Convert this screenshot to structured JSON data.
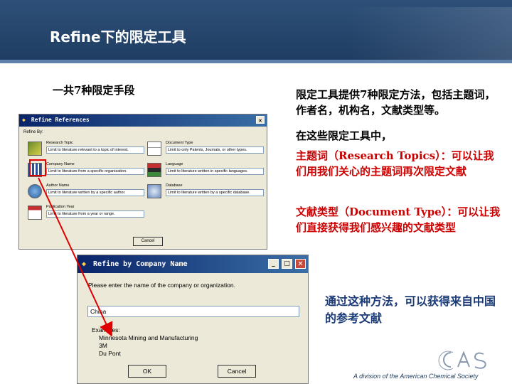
{
  "slide": {
    "title": "Refine下的限定工具",
    "subtitle": "一共7种限定手段",
    "paragraphs": [
      "限定工具提供7种限定方法，包括主题词，作者名，机构名，文献类型等。",
      "在这些限定工具中，",
      "主题词（Research Topics）：可以让我们用我们关心的主题词再次限定文献",
      "文献类型（Document Type）：可以让我们直接获得我们感兴趣的文献类型",
      "通过这种方法，可以获得来自中国的参考文献"
    ],
    "footer": "A division of the American Chemical Society",
    "logo": "cas"
  },
  "refine_dialog": {
    "title": "Refine References",
    "close_icon": "close-icon",
    "refine_by_label": "Refine By:",
    "options": [
      {
        "name": "Research Topic",
        "desc": "Limit to literature relevant to a topic of interest.",
        "icon": "research-topic-icon"
      },
      {
        "name": "Document Type",
        "desc": "Limit to only Patents, Journals, or other types.",
        "icon": "document-type-icon"
      },
      {
        "name": "Company Name",
        "desc": "Limit to literature from a specific organization.",
        "icon": "company-name-icon"
      },
      {
        "name": "Language",
        "desc": "Limit to literature written in specific languages.",
        "icon": "language-icon"
      },
      {
        "name": "Author Name",
        "desc": "Limit to literature written by a specific author.",
        "icon": "author-name-icon"
      },
      {
        "name": "Database",
        "desc": "Limit to literature written by a specific database.",
        "icon": "database-icon"
      },
      {
        "name": "Publication Year",
        "desc": "Limit to literature from a year or range.",
        "icon": "publication-year-icon"
      }
    ],
    "cancel_label": "Cancel"
  },
  "company_dialog": {
    "title": "Refine by Company Name",
    "prompt": "Please enter the name of the company or organization.",
    "input_value": "China",
    "examples_label": "Examples:",
    "examples": [
      "Minnesota Mining and Manufacturing",
      "3M",
      "Du Pont"
    ],
    "ok_label": "OK",
    "cancel_label": "Cancel",
    "window_buttons": [
      "_",
      "□",
      "×"
    ]
  },
  "colors": {
    "header": "#1f3d62",
    "red_text": "#cc0000",
    "blue_text": "#1b3b77",
    "arrow": "#e00000"
  }
}
